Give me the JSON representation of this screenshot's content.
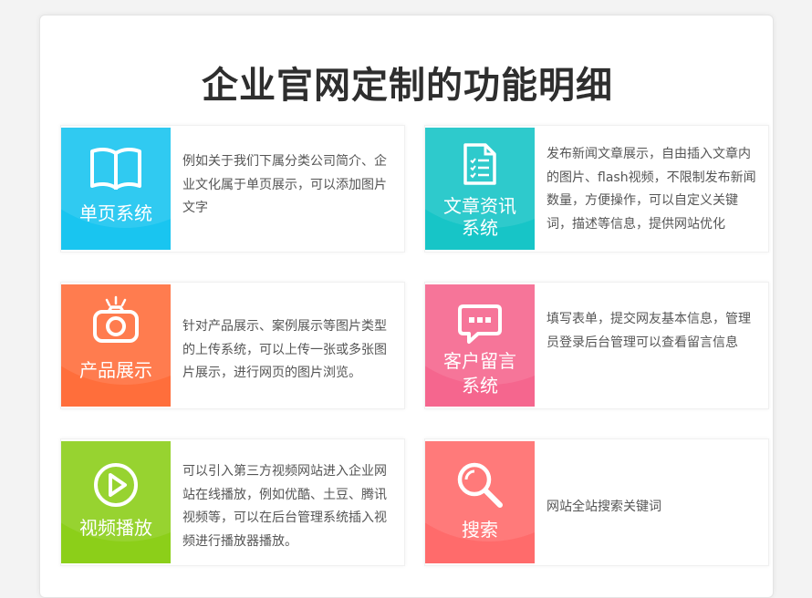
{
  "page": {
    "title": "企业官网定制的功能明细"
  },
  "features": [
    {
      "title": "单页系统",
      "description": "例如关于我们下属分类公司简介、企业文化属于单页展示，可以添加图片文字",
      "icon": "book-icon",
      "color": "#19c5f0"
    },
    {
      "title_line1": "文章资讯",
      "title_line2": "系统",
      "description": "发布新闻文章展示，自由插入文章内的图片、flash视频，不限制发布新闻数量，方便操作，可以自定义关键词，描述等信息，提供网站优化",
      "icon": "document-list-icon",
      "color": "#17c5c7"
    },
    {
      "title": "产品展示",
      "description": "针对产品展示、案例展示等图片类型的上传系统，可以上传一张或多张图片展示，进行网页的图片浏览。",
      "icon": "camera-icon",
      "color": "#ff6e3b"
    },
    {
      "title_line1": "客户留言",
      "title_line2": "系统",
      "description": "填写表单，提交网友基本信息，管理员登录后台管理可以查看留言信息",
      "icon": "chat-bubble-icon",
      "color": "#f5668e"
    },
    {
      "title": "视频播放",
      "description": "可以引入第三方视频网站进入企业网站在线播放，例如优酷、土豆、腾讯视频等，可以在后台管理系统插入视频进行播放器播放。",
      "icon": "play-icon",
      "color": "#8ccf19"
    },
    {
      "title": "搜索",
      "description": "网站全站搜索关键词",
      "icon": "search-icon",
      "color": "#ff6b6b"
    }
  ]
}
